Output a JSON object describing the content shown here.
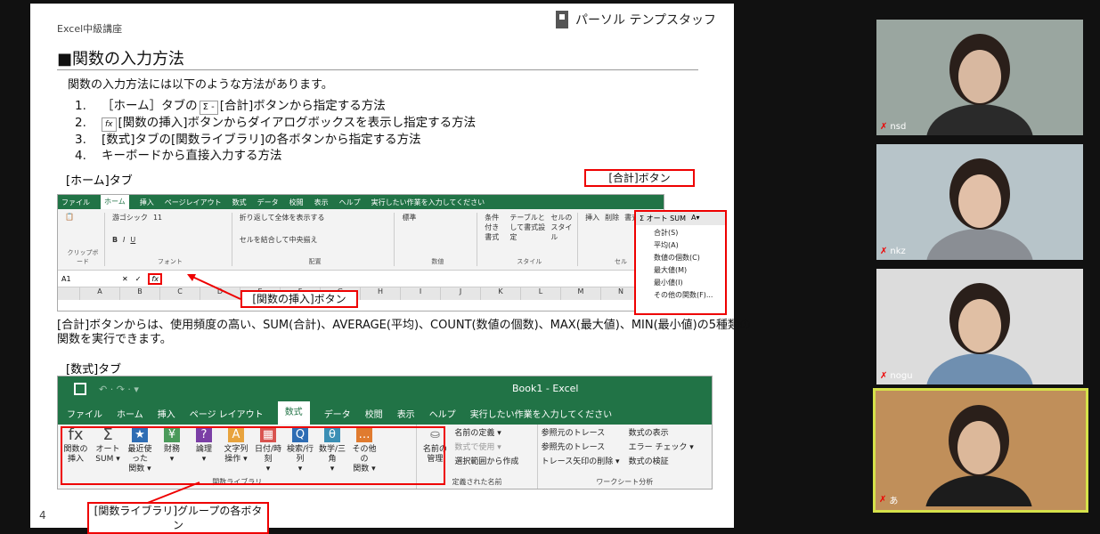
{
  "slide": {
    "course": "Excel中級講座",
    "brand": "パーソル テンプスタッフ",
    "title": "■関数の入力方法",
    "intro": "関数の入力方法には以下のような方法があります。",
    "methods": [
      {
        "num": "1.",
        "pre": "［ホーム］タブの",
        "chip": "Σ -",
        "post": "[合計]ボタンから指定する方法"
      },
      {
        "num": "2.",
        "chip": "fx",
        "post": "[関数の挿入]ボタンからダイアログボックスを表示し指定する方法"
      },
      {
        "num": "3.",
        "text": "[数式]タブの[関数ライブラリ]の各ボタンから指定する方法"
      },
      {
        "num": "4.",
        "text": "キーボードから直接入力する方法"
      }
    ],
    "home_tab_label": "[ホーム]タブ",
    "sum_button_callout": "[合計]ボタン",
    "insert_function_callout": "[関数の挿入]ボタン",
    "description": "[合計]ボタンからは、使用頻度の高い、SUM(合計)、AVERAGE(平均)、COUNT(数値の個数)、MAX(最大値)、MIN(最小値)の5種類の関数を実行できます。",
    "formulas_tab_label": "[数式]タブ",
    "library_callout": "[関数ライブラリ]グループの各ボタン",
    "page_number": "4"
  },
  "home_ribbon": {
    "tabs": [
      "ファイル",
      "ホーム",
      "挿入",
      "ページレイアウト",
      "数式",
      "データ",
      "校閲",
      "表示",
      "ヘルプ",
      "実行したい作業を入力してください"
    ],
    "font_name": "游ゴシック",
    "font_size": "11",
    "wrap_text": "折り返して全体を表示する",
    "merge_center": "セルを結合して中央揃え",
    "number_format": "標準",
    "groups": [
      "クリップボード",
      "フォント",
      "配置",
      "数値",
      "スタイル",
      "セル"
    ],
    "style_buttons": [
      "条件付き書式",
      "テーブルとして書式設定",
      "セルのスタイル"
    ],
    "cell_buttons": [
      "挿入",
      "削除",
      "書式"
    ],
    "name_box": "A1",
    "columns": [
      "A",
      "B",
      "C",
      "D",
      "E",
      "F",
      "G",
      "H",
      "I",
      "J",
      "K",
      "L",
      "M",
      "N"
    ]
  },
  "autosum_menu": {
    "header": "Σ オート SUM",
    "items": [
      "合計(S)",
      "平均(A)",
      "数値の個数(C)",
      "最大値(M)",
      "最小値(I)",
      "その他の関数(F)..."
    ]
  },
  "formulas_ribbon": {
    "book_title": "Book1 - Excel",
    "tabs": [
      "ファイル",
      "ホーム",
      "挿入",
      "ページ レイアウト",
      "数式",
      "データ",
      "校閲",
      "表示",
      "ヘルプ",
      "実行したい作業を入力してください"
    ],
    "library_buttons": [
      {
        "line1": "関数の",
        "line2": "挿入",
        "icon": "fx",
        "color": "#444444"
      },
      {
        "line1": "オート",
        "line2": "SUM ▾",
        "icon": "Σ",
        "color": "#444444"
      },
      {
        "line1": "最近使った",
        "line2": "関数 ▾",
        "icon": "★",
        "color": "#2e6db4"
      },
      {
        "line1": "財務",
        "line2": "▾",
        "icon": "¥",
        "color": "#4a9a5a"
      },
      {
        "line1": "論理",
        "line2": "▾",
        "icon": "?",
        "color": "#7b3fa6"
      },
      {
        "line1": "文字列",
        "line2": "操作 ▾",
        "icon": "A",
        "color": "#e8a33d"
      },
      {
        "line1": "日付/時刻",
        "line2": "▾",
        "icon": "▦",
        "color": "#d9534f"
      },
      {
        "line1": "検索/行列",
        "line2": "▾",
        "icon": "Q",
        "color": "#2e6db4"
      },
      {
        "line1": "数学/三角",
        "line2": "▾",
        "icon": "θ",
        "color": "#3b8fb5"
      },
      {
        "line1": "その他の",
        "line2": "関数 ▾",
        "icon": "…",
        "color": "#e07b2f"
      }
    ],
    "library_group": "関数ライブラリ",
    "name_manager": "名前の管理",
    "defined_names_items": [
      "名前の定義 ▾",
      "数式で使用 ▾",
      "選択範囲から作成"
    ],
    "defined_names_group": "定義された名前",
    "audit_items_left": [
      "参照元のトレース",
      "参照先のトレース",
      "トレース矢印の削除 ▾"
    ],
    "audit_items_right": [
      "数式の表示",
      "エラー チェック ▾",
      "数式の検証"
    ],
    "audit_group": "ワークシート分析"
  },
  "participants": [
    {
      "name": "nsd",
      "bg": "#9aa6a0",
      "face": "#d8b8a0",
      "shirt": "#2a2a2a"
    },
    {
      "name": "nkz",
      "bg": "#b7c4c9",
      "face": "#e2c0a8",
      "shirt": "#8a8e94"
    },
    {
      "name": "nogu",
      "bg": "#dcdcdc",
      "face": "#e0bfa4",
      "shirt": "#6f8fb0"
    },
    {
      "name": "あ",
      "bg": "#c08f5a",
      "face": "#dcb89a",
      "shirt": "#1c1c1c"
    }
  ],
  "colors": {
    "excel_green": "#217346",
    "callout_red": "#e00000",
    "active_speaker": "#d6e24a"
  }
}
